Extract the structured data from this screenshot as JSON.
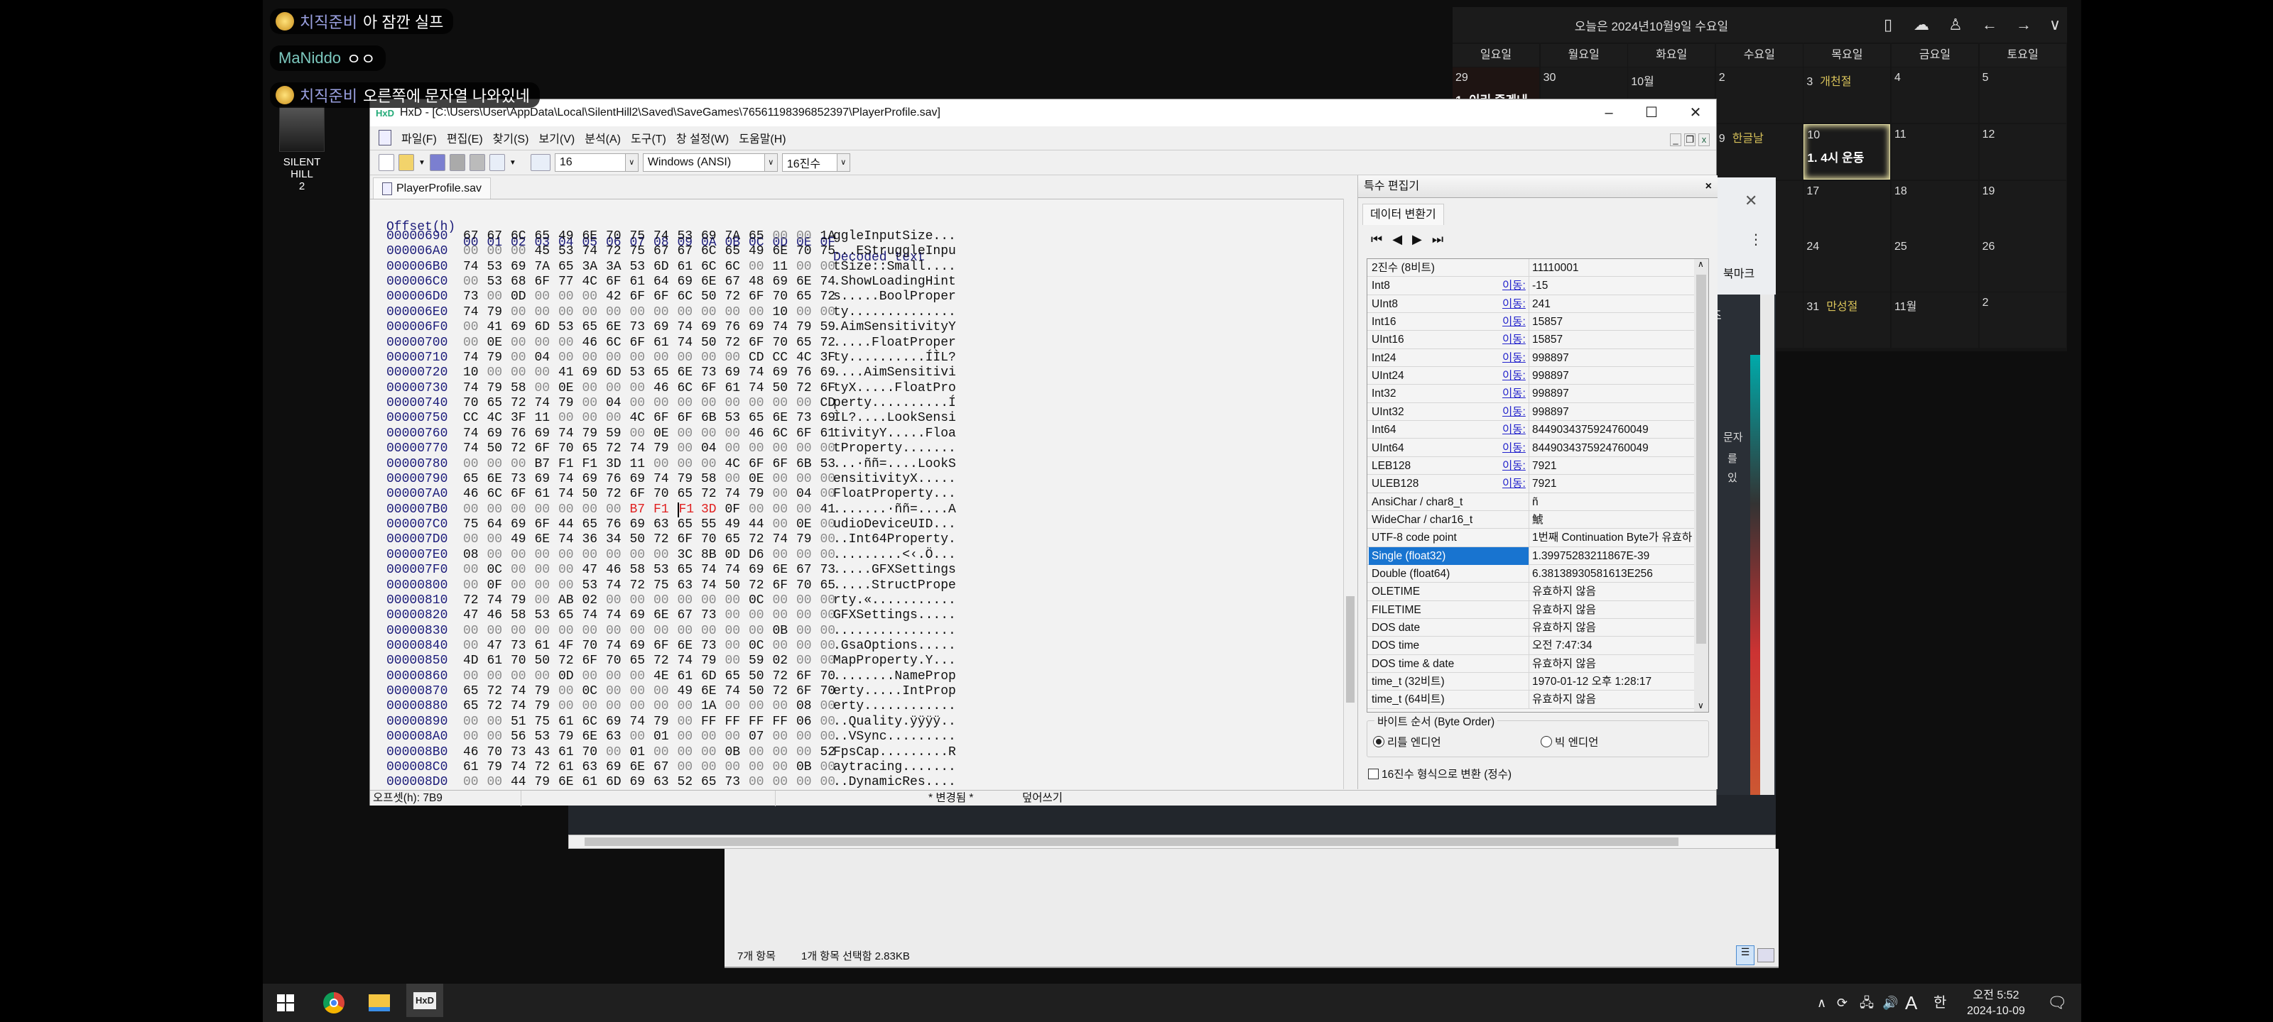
{
  "chat": [
    {
      "name": "치직준비",
      "text": "아 잠깐 실프"
    },
    {
      "name": "MaNiddo",
      "text": "ㅇㅇ"
    },
    {
      "name": "치직준비",
      "text": "오른쪽에 문자열 나와있네"
    }
  ],
  "desktop_icon": {
    "label_line1": "SILENT HILL",
    "label_line2": "2"
  },
  "calendar": {
    "title": "오늘은 2024년10월9일 수요일",
    "weekdays": [
      "일요일",
      "월요일",
      "화요일",
      "수요일",
      "목요일",
      "금요일",
      "토요일"
    ],
    "weeks": [
      [
        {
          "d": "29",
          "ev": "1. 이리 즐겐내"
        },
        {
          "d": "30"
        },
        {
          "d": "10월"
        },
        {
          "d": "2"
        },
        {
          "d": "3",
          "hol": "개천절"
        },
        {
          "d": "4"
        },
        {
          "d": "5"
        }
      ],
      [
        {},
        {},
        {},
        {
          "d": "9",
          "hol": "한글날"
        },
        {
          "d": "10",
          "ev": "1. 4시 운동",
          "today": true
        },
        {
          "d": "11"
        },
        {
          "d": "12"
        }
      ],
      [
        {},
        {},
        {},
        {},
        {
          "d": "17"
        },
        {
          "d": "18"
        },
        {
          "d": "19"
        }
      ],
      [
        {},
        {},
        {},
        {},
        {
          "d": "24"
        },
        {
          "d": "25"
        },
        {
          "d": "26"
        }
      ],
      [
        {},
        {},
        {},
        {},
        {
          "d": "31",
          "hol": "만성절"
        },
        {
          "d": "11월"
        },
        {
          "d": "2"
        }
      ]
    ],
    "holiday_color": "#d8c25a"
  },
  "browser_fragment": {
    "bookmark_text": "북마크",
    "dropdown_text": "즈",
    "side_text": [
      "문자",
      "를",
      "있"
    ]
  },
  "hxd": {
    "title": "HxD - [C:\\Users\\User\\AppData\\Local\\SilentHill2\\Saved\\SaveGames\\76561198396852397\\PlayerProfile.sav]",
    "menu": [
      "파일(F)",
      "편집(E)",
      "찾기(S)",
      "보기(V)",
      "분석(A)",
      "도구(T)",
      "창 설정(W)",
      "도움말(H)"
    ],
    "toolbar": {
      "bytes_per_row": "16",
      "charset": "Windows (ANSI)",
      "offset_base": "16진수"
    },
    "file_tab": "PlayerProfile.sav",
    "header": {
      "offset": "Offset(h)",
      "columns": [
        "00",
        "01",
        "02",
        "03",
        "04",
        "05",
        "06",
        "07",
        "08",
        "09",
        "0A",
        "0B",
        "0C",
        "0D",
        "0E",
        "0F"
      ],
      "decoded": "Decoded text"
    },
    "selection": {
      "start_offset": "7B7",
      "end_offset": "7BA",
      "cursor_offset": "7B9"
    },
    "rows": [
      {
        "off": "00000690",
        "hex": "67 67 6C 65 49 6E 70 75 74 53 69 7A 65 00 00 1A",
        "txt": "ggleInputSize..."
      },
      {
        "off": "000006A0",
        "hex": "00 00 00 45 53 74 72 75 67 67 6C 65 49 6E 70 75",
        "txt": "...EStruggleInpu"
      },
      {
        "off": "000006B0",
        "hex": "74 53 69 7A 65 3A 3A 53 6D 61 6C 6C 00 11 00 00",
        "txt": "tSize::Small...."
      },
      {
        "off": "000006C0",
        "hex": "00 53 68 6F 77 4C 6F 61 64 69 6E 67 48 69 6E 74",
        "txt": ".ShowLoadingHint"
      },
      {
        "off": "000006D0",
        "hex": "73 00 0D 00 00 00 42 6F 6F 6C 50 72 6F 70 65 72",
        "txt": "s.....BoolProper"
      },
      {
        "off": "000006E0",
        "hex": "74 79 00 00 00 00 00 00 00 00 00 00 00 10 00 00",
        "txt": "ty.............."
      },
      {
        "off": "000006F0",
        "hex": "00 41 69 6D 53 65 6E 73 69 74 69 76 69 74 79 59",
        "txt": ".AimSensitivityY"
      },
      {
        "off": "00000700",
        "hex": "00 0E 00 00 00 46 6C 6F 61 74 50 72 6F 70 65 72",
        "txt": ".....FloatProper"
      },
      {
        "off": "00000710",
        "hex": "74 79 00 04 00 00 00 00 00 00 00 00 CD CC 4C 3F",
        "txt": "ty..........ÍÌL?"
      },
      {
        "off": "00000720",
        "hex": "10 00 00 00 41 69 6D 53 65 6E 73 69 74 69 76 69",
        "txt": "....AimSensitivi"
      },
      {
        "off": "00000730",
        "hex": "74 79 58 00 0E 00 00 00 46 6C 6F 61 74 50 72 6F",
        "txt": "tyX.....FloatPro"
      },
      {
        "off": "00000740",
        "hex": "70 65 72 74 79 00 04 00 00 00 00 00 00 00 00 CD",
        "txt": "perty..........Í"
      },
      {
        "off": "00000750",
        "hex": "CC 4C 3F 11 00 00 00 4C 6F 6F 6B 53 65 6E 73 69",
        "txt": "ÌL?....LookSensi"
      },
      {
        "off": "00000760",
        "hex": "74 69 76 69 74 79 59 00 0E 00 00 00 46 6C 6F 61",
        "txt": "tivityY.....Floa"
      },
      {
        "off": "00000770",
        "hex": "74 50 72 6F 70 65 72 74 79 00 04 00 00 00 00 00",
        "txt": "tProperty......."
      },
      {
        "off": "00000780",
        "hex": "00 00 00 B7 F1 F1 3D 11 00 00 00 4C 6F 6F 6B 53",
        "txt": "...·ññ=....LookS"
      },
      {
        "off": "00000790",
        "hex": "65 6E 73 69 74 69 76 69 74 79 58 00 0E 00 00 00",
        "txt": "ensitivityX....."
      },
      {
        "off": "000007A0",
        "hex": "46 6C 6F 61 74 50 72 6F 70 65 72 74 79 00 04 00",
        "txt": "FloatProperty..."
      },
      {
        "off": "000007B0",
        "hex": "00 00 00 00 00 00 00 B7 F1 F1 3D 0F 00 00 00 41",
        "txt": ".......·ññ=....A"
      },
      {
        "off": "000007C0",
        "hex": "75 64 69 6F 44 65 76 69 63 65 55 49 44 00 0E 00",
        "txt": "udioDeviceUID..."
      },
      {
        "off": "000007D0",
        "hex": "00 00 49 6E 74 36 34 50 72 6F 70 65 72 74 79 00",
        "txt": "..Int64Property."
      },
      {
        "off": "000007E0",
        "hex": "08 00 00 00 00 00 00 00 00 3C 8B 0D D6 00 00 00",
        "txt": ".........<‹.Ö..."
      },
      {
        "off": "000007F0",
        "hex": "00 0C 00 00 00 47 46 58 53 65 74 74 69 6E 67 73",
        "txt": ".....GFXSettings"
      },
      {
        "off": "00000800",
        "hex": "00 0F 00 00 00 53 74 72 75 63 74 50 72 6F 70 65",
        "txt": ".....StructPrope"
      },
      {
        "off": "00000810",
        "hex": "72 74 79 00 AB 02 00 00 00 00 00 00 0C 00 00 00",
        "txt": "rty.«..........."
      },
      {
        "off": "00000820",
        "hex": "47 46 58 53 65 74 74 69 6E 67 73 00 00 00 00 00",
        "txt": "GFXSettings....."
      },
      {
        "off": "00000830",
        "hex": "00 00 00 00 00 00 00 00 00 00 00 00 00 0B 00 00",
        "txt": "................"
      },
      {
        "off": "00000840",
        "hex": "00 47 73 61 4F 70 74 69 6F 6E 73 00 0C 00 00 00",
        "txt": ".GsaOptions....."
      },
      {
        "off": "00000850",
        "hex": "4D 61 70 50 72 6F 70 65 72 74 79 00 59 02 00 00",
        "txt": "MapProperty.Y..."
      },
      {
        "off": "00000860",
        "hex": "00 00 00 00 0D 00 00 00 4E 61 6D 65 50 72 6F 70",
        "txt": "........NameProp"
      },
      {
        "off": "00000870",
        "hex": "65 72 74 79 00 0C 00 00 00 49 6E 74 50 72 6F 70",
        "txt": "erty.....IntProp"
      },
      {
        "off": "00000880",
        "hex": "65 72 74 79 00 00 00 00 00 00 1A 00 00 00 08 00",
        "txt": "erty............"
      },
      {
        "off": "00000890",
        "hex": "00 00 51 75 61 6C 69 74 79 00 FF FF FF FF 06 00",
        "txt": "..Quality.ÿÿÿÿ.."
      },
      {
        "off": "000008A0",
        "hex": "00 00 56 53 79 6E 63 00 01 00 00 00 07 00 00 00",
        "txt": "..VSync........."
      },
      {
        "off": "000008B0",
        "hex": "46 70 73 43 61 70 00 01 00 00 00 0B 00 00 00 52",
        "txt": "FpsCap.........R"
      },
      {
        "off": "000008C0",
        "hex": "61 79 74 72 61 63 69 6E 67 00 00 00 00 00 0B 00",
        "txt": "aytracing......."
      },
      {
        "off": "000008D0",
        "hex": "00 00 44 79 6E 61 6D 69 63 52 65 73 00 00 00 00",
        "txt": "..DynamicRes...."
      }
    ],
    "inspector": {
      "panel_title": "특수 편집기",
      "tab": "데이터 변환기",
      "goto_label": "이동:",
      "rows": [
        {
          "label": "2진수 (8비트)",
          "value": "11110001"
        },
        {
          "label": "Int8",
          "value": "-15",
          "goto": true
        },
        {
          "label": "UInt8",
          "value": "241",
          "goto": true
        },
        {
          "label": "Int16",
          "value": "15857",
          "goto": true
        },
        {
          "label": "UInt16",
          "value": "15857",
          "goto": true
        },
        {
          "label": "Int24",
          "value": "998897",
          "goto": true
        },
        {
          "label": "UInt24",
          "value": "998897",
          "goto": true
        },
        {
          "label": "Int32",
          "value": "998897",
          "goto": true
        },
        {
          "label": "UInt32",
          "value": "998897",
          "goto": true
        },
        {
          "label": "Int64",
          "value": "8449034375924760049",
          "goto": true
        },
        {
          "label": "UInt64",
          "value": "8449034375924760049",
          "goto": true
        },
        {
          "label": "LEB128",
          "value": "7921",
          "goto": true
        },
        {
          "label": "ULEB128",
          "value": "7921",
          "goto": true
        },
        {
          "label": "AnsiChar / char8_t",
          "value": "ñ"
        },
        {
          "label": "WideChar / char16_t",
          "value": "鯱"
        },
        {
          "label": "UTF-8 code point",
          "value": "1번째 Continuation Byte가 유효하지 않음"
        },
        {
          "label": "Single (float32)",
          "value": "1.39975283211867E-39",
          "selected": true
        },
        {
          "label": "Double (float64)",
          "value": "6.38138930581613E256"
        },
        {
          "label": "OLETIME",
          "value": "유효하지 않음"
        },
        {
          "label": "FILETIME",
          "value": "유효하지 않음"
        },
        {
          "label": "DOS date",
          "value": "유효하지 않음"
        },
        {
          "label": "DOS time",
          "value": "오전 7:47:34"
        },
        {
          "label": "DOS time & date",
          "value": "유효하지 않음"
        },
        {
          "label": "time_t (32비트)",
          "value": "1970-01-12 오후 1:28:17"
        },
        {
          "label": "time_t (64비트)",
          "value": "유효하지 않음"
        }
      ],
      "byte_order_label": "바이트 순서 (Byte Order)",
      "little_endian": "리틀 엔디언",
      "big_endian": "빅 엔디언",
      "selected_byte_order": "little",
      "hex_checkbox": "16진수 형식으로 변환 (정수)",
      "hex_checkbox_checked": false
    },
    "status": {
      "offset": "오프셋(h): 7B9",
      "modified": "* 변경됨 *",
      "mode": "덮어쓰기"
    }
  },
  "explorer": {
    "item_count": "7개 항목",
    "selected": "1개 항목 선택함 2.83KB"
  },
  "taskbar": {
    "apps": [
      "start-icon",
      "chrome-icon",
      "file-explorer-icon",
      "hxd-icon"
    ],
    "ime": "A",
    "ime_lang": "한",
    "time": "오전 5:52",
    "date": "2024-10-09"
  }
}
